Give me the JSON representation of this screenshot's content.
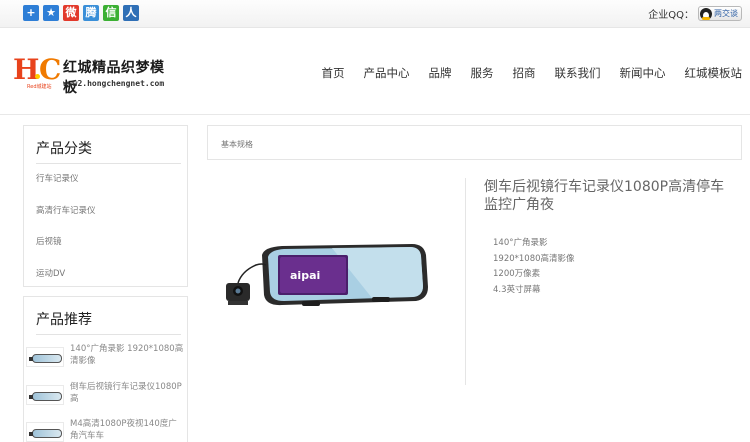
{
  "topbar": {
    "share_icons": [
      {
        "icon": "plus-share-icon",
        "color": "#2e7ed6",
        "glyph": "+"
      },
      {
        "icon": "star-share-icon",
        "color": "#2e7ed6",
        "glyph": "★"
      },
      {
        "icon": "weibo-icon",
        "color": "#e2392b",
        "glyph": "微"
      },
      {
        "icon": "tencent-weibo-icon",
        "color": "#3a8fd8",
        "glyph": "腾"
      },
      {
        "icon": "wechat-icon",
        "color": "#3cb034",
        "glyph": "信"
      },
      {
        "icon": "renren-icon",
        "color": "#2f6fb6",
        "glyph": "人"
      }
    ],
    "qq_label": "企业QQ：",
    "qq_button": "两交谈"
  },
  "header": {
    "logo_small": "Red城建站",
    "logo_title": "红城精品织梦模板",
    "logo_url": "www2.hongchengnet.com",
    "nav": [
      "首页",
      "产品中心",
      "品牌",
      "服务",
      "招商",
      "联系我们",
      "新闻中心",
      "红城模板站"
    ]
  },
  "sidebar": {
    "categories_title": "产品分类",
    "categories": [
      "行车记录仪",
      "高清行车记录仪",
      "后视镜",
      "运动DV"
    ],
    "recommend_title": "产品推荐",
    "recommend": [
      "140°广角录影 1920*1080高清影像",
      "倒车后视镜行车记录仪1080P高",
      "M4高清1080P夜视140度广角汽车车"
    ]
  },
  "main": {
    "breadcrumb": "基本规格",
    "product_title": "倒车后视镜行车记录仪1080P高清停车监控广角夜",
    "product_logo": "aipai",
    "specs": [
      "140°广角录影",
      "1920*1080高清影像",
      "1200万像素",
      "4.3英寸屏幕"
    ]
  }
}
